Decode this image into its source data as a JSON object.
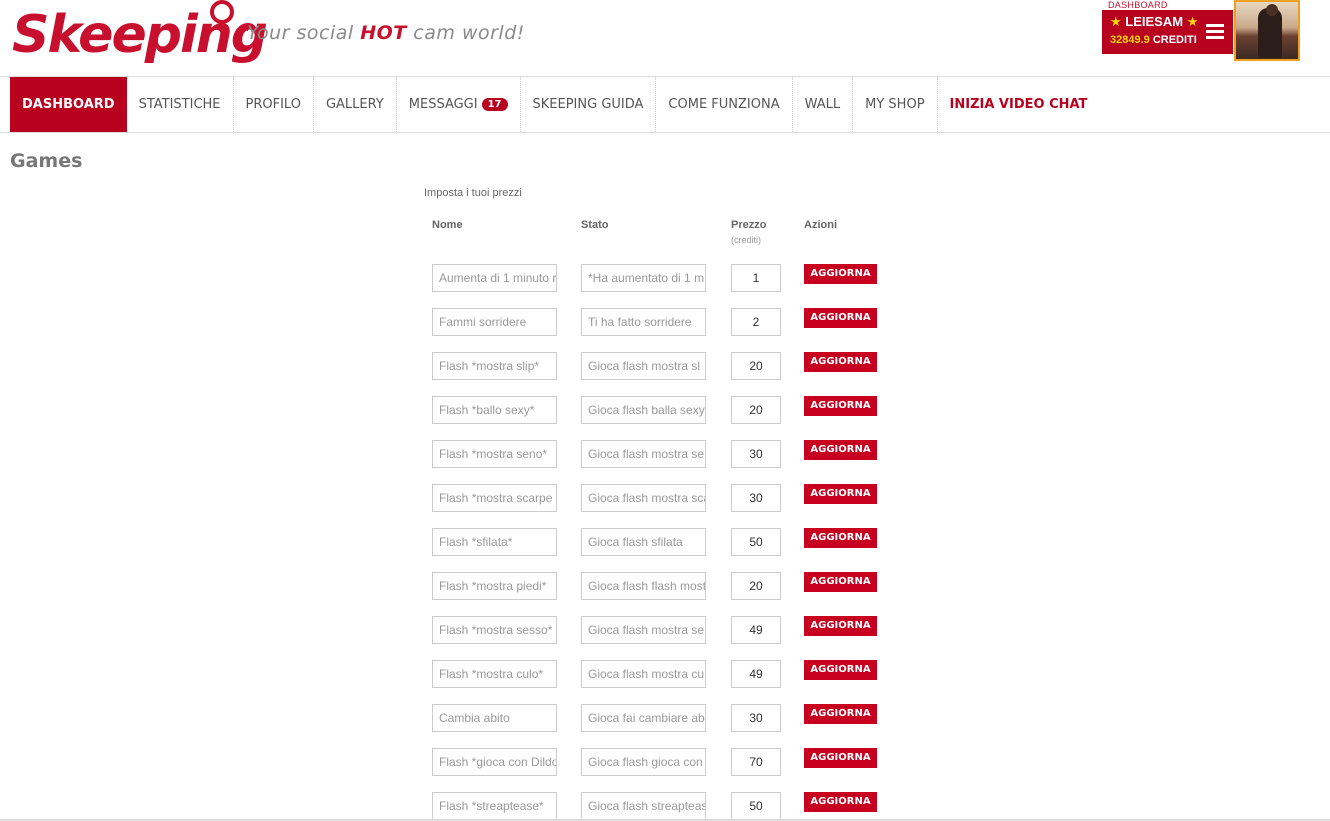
{
  "header": {
    "logo_text": "Skeeping",
    "tagline_pre": "Your social ",
    "tagline_hot": "HOT",
    "tagline_post": " cam world!",
    "dashboard_label": "DASHBOARD",
    "username": "LEIESAM",
    "credits_value": "32849.9",
    "credits_label": "CREDITI",
    "star": "★"
  },
  "nav": {
    "items": [
      {
        "label": "DASHBOARD"
      },
      {
        "label": "STATISTICHE"
      },
      {
        "label": "PROFILO"
      },
      {
        "label": "GALLERY"
      },
      {
        "label": "MESSAGGI",
        "badge": "17"
      },
      {
        "label": "SKEEPING GUIDA"
      },
      {
        "label": "COME FUNZIONA"
      },
      {
        "label": "WALL"
      },
      {
        "label": "MY SHOP"
      },
      {
        "label": "INIZIA VIDEO CHAT"
      }
    ]
  },
  "page": {
    "title": "Games",
    "subtitle": "Imposta i tuoi prezzi"
  },
  "table": {
    "headers": {
      "nome": "Nome",
      "stato": "Stato",
      "prezzo": "Prezzo",
      "prezzo_sub": "(crediti)",
      "azioni": "Azioni"
    },
    "button_label": "AGGIORNA",
    "rows": [
      {
        "nome": "Aumenta di 1 minuto r",
        "stato": "*Ha aumentato di 1 m",
        "prezzo": "1"
      },
      {
        "nome": "Fammi sorridere",
        "stato": "Ti ha fatto sorridere",
        "prezzo": "2"
      },
      {
        "nome": "Flash *mostra slip*",
        "stato": "Gioca flash mostra  sl",
        "prezzo": "20"
      },
      {
        "nome": "Flash *ballo sexy*",
        "stato": "Gioca  flash balla sexy",
        "prezzo": "20"
      },
      {
        "nome": "Flash *mostra seno*",
        "stato": "Gioca flash mostra se",
        "prezzo": "30"
      },
      {
        "nome": "Flash *mostra scarpe",
        "stato": "Gioca flash mostra sca",
        "prezzo": "30"
      },
      {
        "nome": "Flash *sfilata*",
        "stato": "Gioca flash sfilata",
        "prezzo": "50"
      },
      {
        "nome": "Flash *mostra piedi*",
        "stato": "Gioca flash flash most",
        "prezzo": "20"
      },
      {
        "nome": "Flash *mostra sesso*",
        "stato": "Gioca flash mostra se",
        "prezzo": "49"
      },
      {
        "nome": "Flash *mostra culo*",
        "stato": "Gioca flash mostra cu",
        "prezzo": "49"
      },
      {
        "nome": "Cambia abito",
        "stato": "Gioca fai cambiare abi",
        "prezzo": "30"
      },
      {
        "nome": "Flash *gioca con Dildo",
        "stato": "Gioca flash gioca con l",
        "prezzo": "70"
      },
      {
        "nome": "Flash *streaptease*",
        "stato": "Gioca flash streapteas",
        "prezzo": "50"
      }
    ]
  },
  "colors": {
    "brand_red": "#c8102e",
    "nav_active": "#b8001f",
    "credits_gold": "#ffd700",
    "avatar_border": "#f0a020"
  }
}
